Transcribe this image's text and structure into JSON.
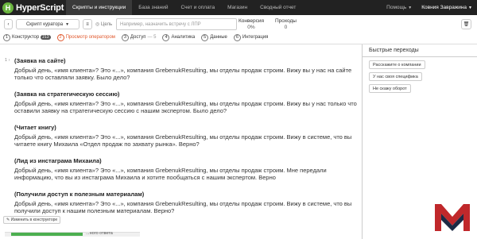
{
  "topbar": {
    "logo_text": "HyperScript",
    "nav": [
      "Скрипты и инструкции",
      "База знаний",
      "Счет и оплата",
      "Магазин",
      "Сводный отчет"
    ],
    "help": "Помощь",
    "user": "Ковния Завражина"
  },
  "toolbar": {
    "back": "‹",
    "script_select": "Скрипт куратора",
    "menu": "≡",
    "goal_label": "Цель",
    "goal_placeholder": "Например, назначить встречу с ЛПР",
    "conversion_label": "Конверсия",
    "conversion_value": "0%",
    "passes_label": "Проходы",
    "passes_value": "0",
    "trash": "🗑"
  },
  "steps": [
    {
      "num": "1",
      "label": "Конструктор",
      "badge": "213"
    },
    {
      "num": "2",
      "label": "Просмотр оператором"
    },
    {
      "num": "3",
      "label": "Доступ",
      "muted": "— 5"
    },
    {
      "num": "4",
      "label": "Аналитика"
    },
    {
      "num": "5",
      "label": "Данные"
    },
    {
      "num": "6",
      "label": "Интеграция"
    }
  ],
  "main": {
    "line_number": "1",
    "blocks": [
      {
        "title": "(Заявка на сайте)",
        "text": "Добрый день, «имя клиента»? Это «...», компания GrebenukResulting, мы отделы продаж строим. Вижу вы у нас на сайте только что оставляли заявку. Было дело?"
      },
      {
        "title": "(Заявка на стратегическую сессию)",
        "text": "Добрый день, «имя клиента»? Это «...», компания GrebenukResulting, мы отделы продаж строим. Вижу вы у нас только что оставили заявку на стратегическую сессию с нашим экспертом. Было дело?"
      },
      {
        "title": "(Читает книгу)",
        "text": "Добрый день, «имя клиента»? Это «...», компания GrebenukResulting, мы отделы продаж строим. Вижу в системе, что вы читаете книгу Михаила «Отдел продаж по захвату рынка». Верно?"
      },
      {
        "title": "(Лид из инстаграма Михаила)",
        "text": "Добрый день, «имя клиента»? Это «...», компания GrebenukResulting, мы отделы продаж строим. Мне передали информацию, что вы из инстаграма Михаила и хотите пообщаться с нашим экспертом. Верно"
      },
      {
        "title": "(Получили доступ к полезным материалам)",
        "text": "Добрый день, «имя клиента»? Это «...», компания GrebenukResulting, мы отделы продаж строим. Вижу в системе, что вы получили доступ к нашим полезным материалам. Верно?"
      }
    ],
    "edit_button": "✎ Изменить в конструкторе",
    "bottom_text": "...ного ответа"
  },
  "side": {
    "title": "Быстрые переходы",
    "buttons": [
      "Расскажите о компании",
      "У нас своя специфика",
      "Не скажу оборот"
    ]
  }
}
